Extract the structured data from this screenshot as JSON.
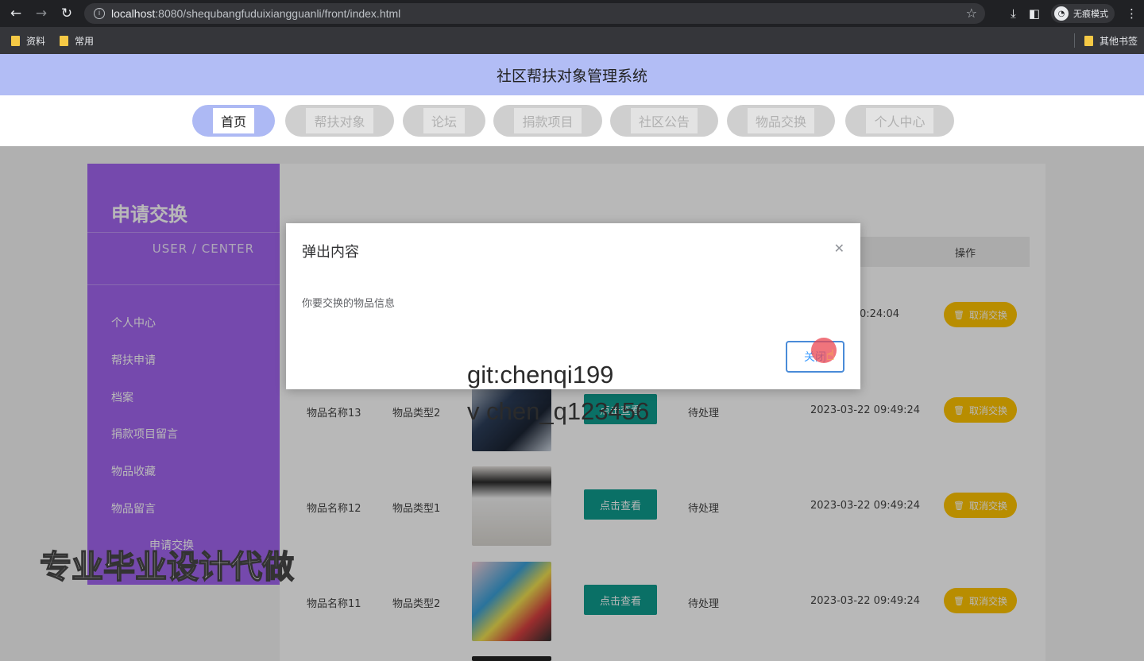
{
  "browser": {
    "url_host": "localhost",
    "url_path": ":8080/shequbangfuduixiangguanli/front/index.html",
    "incognito_label": "无痕模式",
    "bookmarks": [
      "资料",
      "常用"
    ],
    "bookmarks_right": "其他书签"
  },
  "site": {
    "title": "社区帮扶对象管理系统",
    "nav": [
      "首页",
      "帮扶对象",
      "论坛",
      "捐款项目",
      "社区公告",
      "物品交换",
      "个人中心"
    ]
  },
  "sidebar": {
    "title": "申请交换",
    "subtitle": "USER / CENTER",
    "items": [
      "个人中心",
      "帮扶申请",
      "档案",
      "捐款项目留言",
      "物品收藏",
      "物品留言",
      "申请交换"
    ]
  },
  "table": {
    "header_op": "操作",
    "view_label": "点击查看",
    "cancel_label": "取消交换",
    "rows": [
      {
        "name": "",
        "type": "",
        "status": "",
        "time": "2023-03-22 10:24:04"
      },
      {
        "name": "物品名称13",
        "type": "物品类型2",
        "status": "待处理",
        "time": "2023-03-22 09:49:24"
      },
      {
        "name": "物品名称12",
        "type": "物品类型1",
        "status": "待处理",
        "time": "2023-03-22 09:49:24"
      },
      {
        "name": "物品名称11",
        "type": "物品类型2",
        "status": "待处理",
        "time": "2023-03-22 09:49:24"
      }
    ]
  },
  "dialog": {
    "title": "弹出内容",
    "body": "你要交换的物品信息",
    "button": "关闭"
  },
  "watermarks": {
    "git": "git:chenqi199",
    "v": "v  chen_q123456",
    "promo": "专业毕业设计代做"
  }
}
